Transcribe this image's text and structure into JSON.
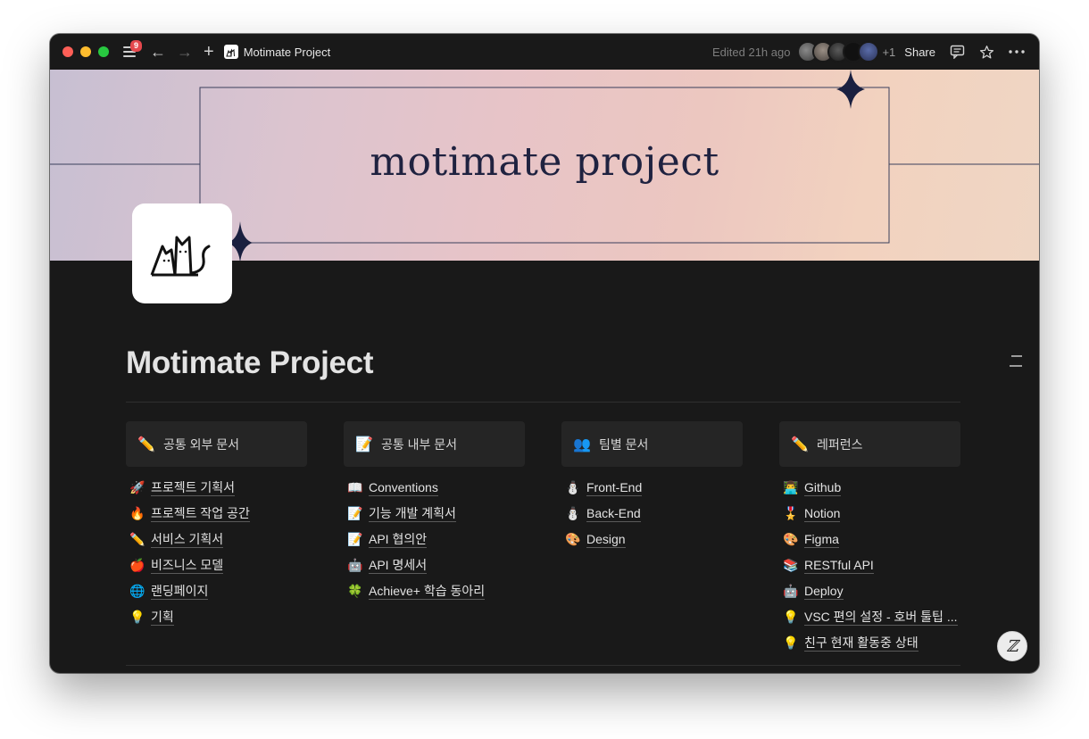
{
  "titlebar": {
    "notification_count": "9",
    "page_name": "Motimate Project",
    "edited": "Edited 21h ago",
    "extra_viewers": "+1",
    "share_label": "Share"
  },
  "cover": {
    "title": "motimate project"
  },
  "page": {
    "title": "Motimate Project"
  },
  "columns": [
    {
      "icon": "✏️",
      "header": "공통 외부 문서",
      "links": [
        {
          "icon": "🚀",
          "label": "프로젝트 기획서"
        },
        {
          "icon": "🔥",
          "label": "프로젝트 작업 공간"
        },
        {
          "icon": "✏️",
          "label": "서비스 기획서"
        },
        {
          "icon": "🍎",
          "label": "비즈니스 모델"
        },
        {
          "icon": "🌐",
          "label": "랜딩페이지"
        },
        {
          "icon": "💡",
          "label": "기획"
        }
      ]
    },
    {
      "icon": "📝",
      "header": "공통 내부 문서",
      "links": [
        {
          "icon": "📖",
          "label": "Conventions"
        },
        {
          "icon": "📝",
          "label": "기능 개발 계획서"
        },
        {
          "icon": "📝",
          "label": "API 협의안"
        },
        {
          "icon": "🤖",
          "label": "API 명세서"
        },
        {
          "icon": "🍀",
          "label": "Achieve+ 학습 동아리"
        }
      ]
    },
    {
      "icon": "👥",
      "header": "팀별 문서",
      "links": [
        {
          "icon": "⛄",
          "label": "Front-End"
        },
        {
          "icon": "⛄",
          "label": "Back-End"
        },
        {
          "icon": "🎨",
          "label": "Design"
        }
      ]
    },
    {
      "icon": "✏️",
      "header": "레퍼런스",
      "links": [
        {
          "icon": "👨‍💻",
          "label": "Github"
        },
        {
          "icon": "🎖️",
          "label": "Notion"
        },
        {
          "icon": "🎨",
          "label": "Figma"
        },
        {
          "icon": "📚",
          "label": "RESTful API"
        },
        {
          "icon": "🤖",
          "label": "Deploy"
        },
        {
          "icon": "💡",
          "label": "VSC 편의 설정 - 호버 툴팁 ..."
        },
        {
          "icon": "💡",
          "label": "친구 현재 활동중 상태"
        }
      ]
    }
  ],
  "colors": {
    "background": "#191919",
    "header_block": "#252525",
    "text": "#e3e3e3",
    "cover_ink": "#1f2240"
  }
}
